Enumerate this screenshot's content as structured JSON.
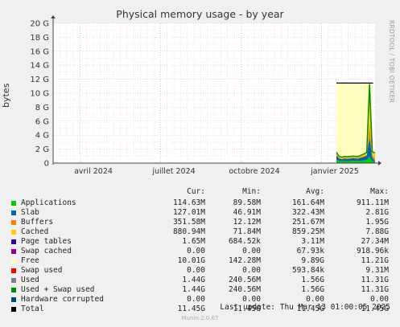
{
  "chart_data": {
    "type": "area",
    "title": "Physical memory usage - by year",
    "ylabel": "bytes",
    "yticks": [
      "0",
      "2 G",
      "4 G",
      "6 G",
      "8 G",
      "10 G",
      "12 G",
      "14 G",
      "16 G",
      "18 G",
      "20 G"
    ],
    "ylim": [
      0,
      20
    ],
    "yunit": "G",
    "xticks": [
      "avril 2024",
      "juillet 2024",
      "octobre 2024",
      "janvier 2025"
    ],
    "grid": true,
    "data_start_month_fraction": 0.88,
    "series": [
      {
        "name": "Applications",
        "color": "#00cc00"
      },
      {
        "name": "Slab",
        "color": "#0066b3"
      },
      {
        "name": "Buffers",
        "color": "#ff8000"
      },
      {
        "name": "Cached",
        "color": "#ffcc00"
      },
      {
        "name": "Page tables",
        "color": "#330099"
      },
      {
        "name": "Swap cached",
        "color": "#990099"
      },
      {
        "name": "Free",
        "color": "#ffffc0"
      },
      {
        "name": "Swap used",
        "color": "#ff0000"
      },
      {
        "name": "Used",
        "color": "#808080"
      },
      {
        "name": "Used + Swap used",
        "color": "#008f00"
      },
      {
        "name": "Hardware corrupted",
        "color": "#00487d"
      },
      {
        "name": "Total",
        "color": "#000000"
      }
    ],
    "total_level": 11.45,
    "free_level": 11.21,
    "used_spike": 11.31
  },
  "legend": {
    "headers": [
      "Cur:",
      "Min:",
      "Avg:",
      "Max:"
    ],
    "rows": [
      {
        "name": "Applications",
        "cur": "114.63M",
        "min": "89.58M",
        "avg": "161.64M",
        "max": "911.11M"
      },
      {
        "name": "Slab",
        "cur": "127.01M",
        "min": "46.91M",
        "avg": "322.43M",
        "max": "2.81G"
      },
      {
        "name": "Buffers",
        "cur": "351.58M",
        "min": "12.12M",
        "avg": "251.67M",
        "max": "1.95G"
      },
      {
        "name": "Cached",
        "cur": "880.94M",
        "min": "71.84M",
        "avg": "859.25M",
        "max": "7.88G"
      },
      {
        "name": "Page tables",
        "cur": "1.65M",
        "min": "684.52k",
        "avg": "3.11M",
        "max": "27.34M"
      },
      {
        "name": "Swap cached",
        "cur": "0.00",
        "min": "0.00",
        "avg": "67.93k",
        "max": "918.96k"
      },
      {
        "name": "Free",
        "cur": "10.01G",
        "min": "142.28M",
        "avg": "9.89G",
        "max": "11.21G"
      },
      {
        "name": "Swap used",
        "cur": "0.00",
        "min": "0.00",
        "avg": "593.84k",
        "max": "9.31M"
      },
      {
        "name": "Used",
        "cur": "1.44G",
        "min": "240.56M",
        "avg": "1.56G",
        "max": "11.31G"
      },
      {
        "name": "Used + Swap used",
        "cur": "1.44G",
        "min": "240.56M",
        "avg": "1.56G",
        "max": "11.31G"
      },
      {
        "name": "Hardware corrupted",
        "cur": "0.00",
        "min": "0.00",
        "avg": "0.00",
        "max": "0.00"
      },
      {
        "name": "Total",
        "cur": "11.45G",
        "min": "11.45G",
        "avg": "11.45G",
        "max": "11.45G"
      }
    ]
  },
  "footer": "Last update: Thu Mar 13 01:00:05 2025",
  "watermark": "RRDTOOL / TOBI OETIKER",
  "generator": "Munin 2.0.67"
}
